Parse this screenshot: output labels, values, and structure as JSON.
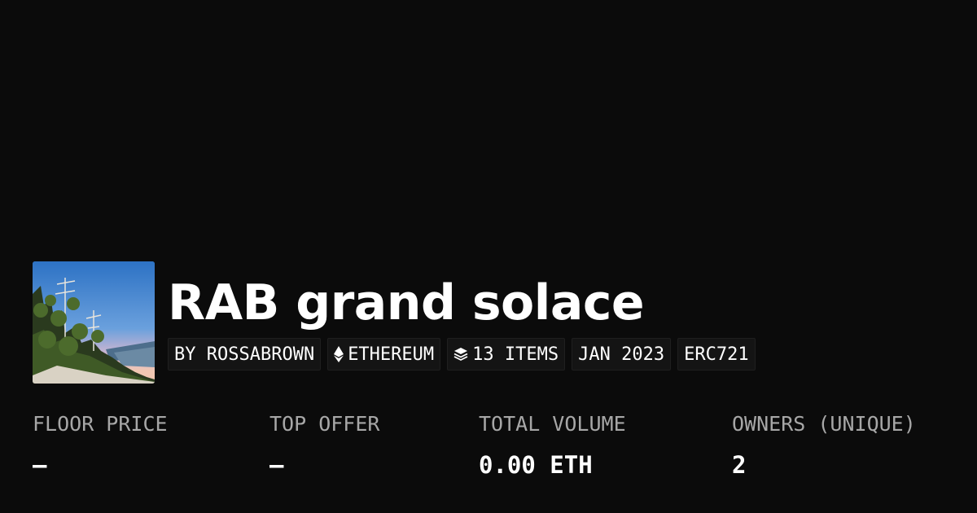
{
  "collection": {
    "title": "RAB grand solace",
    "thumbnail_icon": "landscape-thumbnail"
  },
  "tags": {
    "creator": "BY ROSSABROWN",
    "chain": "ETHEREUM",
    "chain_icon": "ethereum-icon",
    "items": "13 ITEMS",
    "items_icon": "layers-icon",
    "date": "JAN 2023",
    "standard": "ERC721"
  },
  "stats": {
    "floor_price": {
      "label": "FLOOR PRICE",
      "value": "—"
    },
    "top_offer": {
      "label": "TOP OFFER",
      "value": "—"
    },
    "total_volume": {
      "label": "TOTAL VOLUME",
      "value": "0.00 ETH"
    },
    "owners": {
      "label": "OWNERS (UNIQUE)",
      "value": "2"
    }
  },
  "colors": {
    "background": "#0b0b0b",
    "text": "#ffffff",
    "muted": "#a7a7a7",
    "tag_bg": "#141414"
  }
}
